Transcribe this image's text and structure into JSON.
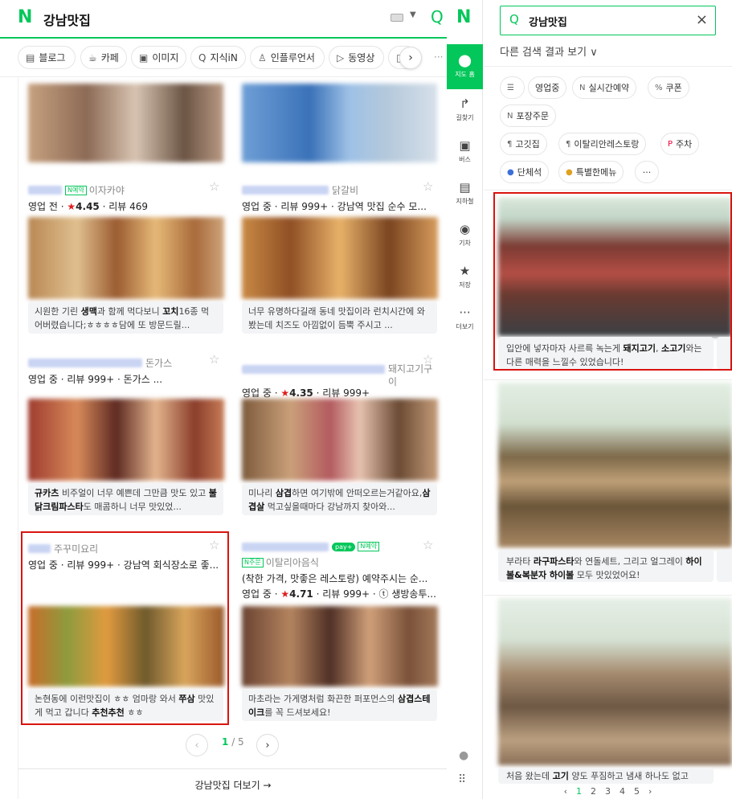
{
  "left": {
    "logo": "N",
    "query": "강남맛집",
    "tabs": [
      {
        "label": "블로그",
        "icon": "▤"
      },
      {
        "label": "카페",
        "icon": "☕"
      },
      {
        "label": "이미지",
        "icon": "▣"
      },
      {
        "label": "지식iN",
        "icon": "Q"
      },
      {
        "label": "인플루언서",
        "icon": "♙"
      },
      {
        "label": "동영상",
        "icon": "▷"
      },
      {
        "label": "쇼핑",
        "icon": "□"
      }
    ],
    "tab_more": "···",
    "cards": [
      {
        "name": "",
        "category": "이자카야",
        "badges": [
          "N예약"
        ],
        "meta_prefix": "영업 전 · ",
        "rating": "4.45",
        "meta_suffix": " · 리뷰 469",
        "review_html": "시원한 기린 <b>생맥</b>과 함께 먹다보니 <b>꼬치</b>16종 먹어버렸습니다;ㅎㅎㅎㅎ담에 또 방문드릴..."
      },
      {
        "name": "",
        "category": "닭갈비",
        "badges": [],
        "meta_prefix": "영업 중 · 리뷰 999+ · 강남역 맛집 순수 모...",
        "rating": "",
        "meta_suffix": "",
        "review_html": "너무 유명하다길래 동네 맛집이라 런치시간에 와봤는데 치즈도 아낌없이 듬뿍 주시고 ..."
      },
      {
        "name": "",
        "category": "돈가스",
        "badges": [],
        "meta_prefix": "영업 중 · 리뷰 999+ · 돈가스 ...",
        "rating": "",
        "meta_suffix": "",
        "review_html": "<b>규카츠</b> 비주얼이 너무 예쁜데 그만큼 맛도 있고 <b>불닭크림파스타</b>도 매콤하니 너무 맛있었..."
      },
      {
        "name": "",
        "category": "돼지고기구이",
        "badges": [],
        "meta_prefix": "영업 중 · ",
        "rating": "4.35",
        "meta_suffix": " · 리뷰 999+",
        "review_html": "미나리 <b>삼겹</b>하면 여기밖에 안떠오르는거같아요,<b>삼겹살</b> 먹고싶을때마다 강남까지 찾아와..."
      },
      {
        "name": "",
        "category": "주꾸미요리",
        "badges": [],
        "meta_prefix": "영업 중 · 리뷰 999+ · 강남역 회식장소로 좋...",
        "rating": "",
        "meta_suffix": "",
        "review_html": "논현동에 이런맛집이 ㅎㅎ 엄마랑 와서 <b>쭈삼</b> 맛있게 먹고 갑니다 <b>추천추천</b> ㅎㅎ"
      },
      {
        "name": "",
        "category": "이탈리아음식",
        "badges": [
          "N주문"
        ],
        "desc": "(착한 가격, 맛좋은 레스토랑) 예약주시는 순...",
        "meta_prefix": "영업 중 · ",
        "rating": "4.71",
        "meta_suffix": " · 리뷰 999+ · ⓣ 생방송투...",
        "review_html": "마초라는 가게명처럼 화끈한 퍼포먼스의 <b>삼겹스테이크</b>를 꼭 드셔보세요!"
      }
    ],
    "pay_badge": "pay+",
    "reserve_badge": "N예약",
    "pager": {
      "current": "1",
      "total": "/ 5"
    },
    "more_label": "강남맛집 더보기 →"
  },
  "nav": {
    "logo": "N",
    "items": [
      {
        "label": "지도 홈",
        "icon": "⬤"
      },
      {
        "label": "길찾기",
        "icon": "↱"
      },
      {
        "label": "버스",
        "icon": "▣"
      },
      {
        "label": "지하철",
        "icon": "▤"
      },
      {
        "label": "기차",
        "icon": "◉"
      },
      {
        "label": "저장",
        "icon": "★"
      },
      {
        "label": "더보기",
        "icon": "···"
      }
    ]
  },
  "right": {
    "search_value": "강남맛집",
    "other_results": "다른 검색 결과 보기 ∨",
    "chips": [
      {
        "label": "",
        "icon": "☰"
      },
      {
        "label": "영업중",
        "icon": ""
      },
      {
        "label": "실시간예약",
        "icon": "N"
      },
      {
        "label": "쿠폰",
        "icon": "%"
      },
      {
        "label": "포장주문",
        "icon": "N"
      },
      {
        "label": "고깃집",
        "icon": "¶"
      },
      {
        "label": "이탈리안레스토랑",
        "icon": "¶"
      },
      {
        "label": "주차",
        "icon": "P"
      },
      {
        "label": "단체석",
        "icon": "●"
      },
      {
        "label": "특별한메뉴",
        "icon": "●"
      },
      {
        "label": "···",
        "icon": ""
      }
    ],
    "cards": [
      {
        "review_html": "입안에 넣자마자 사르륵 녹는게 <b>돼지고기</b>, <b>소고기</b>와는 다른 매력을 느낄수 있었습니다!"
      },
      {
        "review_html": "부라타 <b>라구파스타</b>와 연돌세트, 그리고 얼그레이 <b>하이볼&amp;복분자 하이볼</b> 모두 맛있었어요!"
      },
      {
        "review_html": "처음 왔는데 <b>고기</b> 양도 푸짐하고 냄새 하나도 없고"
      }
    ],
    "pager": [
      "‹",
      "1",
      "2",
      "3",
      "4",
      "5",
      "›"
    ]
  }
}
